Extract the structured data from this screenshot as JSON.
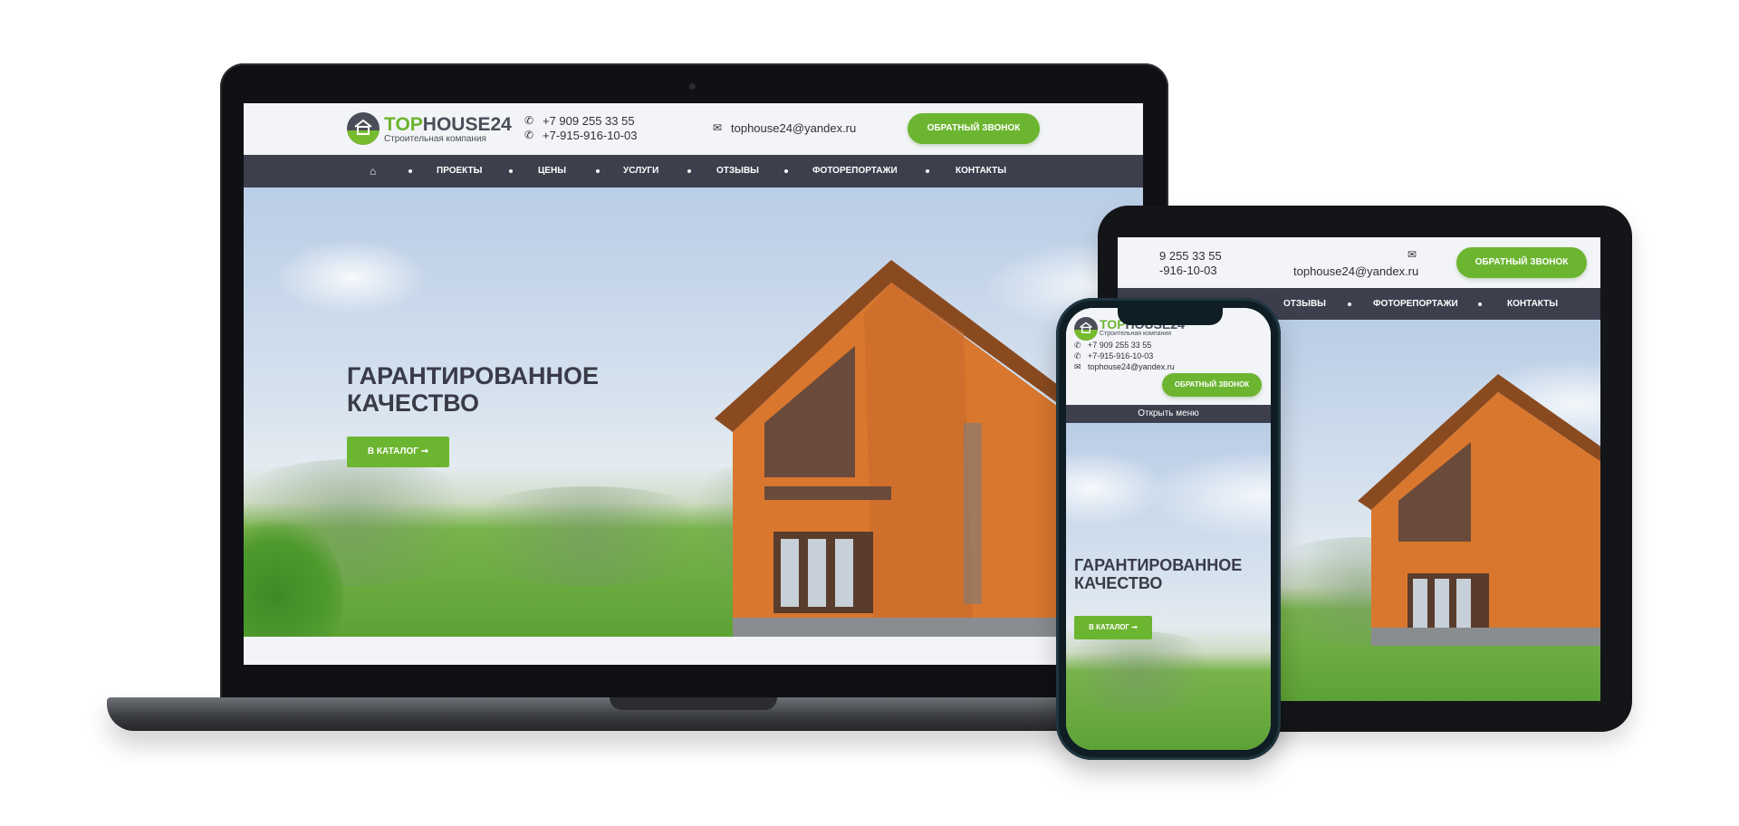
{
  "brand": {
    "logo_top": "TOP",
    "logo_rest": "HOUSE24",
    "tagline": "Строительная компания"
  },
  "contacts": {
    "phone1": "+7 909 255 33 55",
    "phone2": "+7-915-916-10-03",
    "email": "tophouse24@yandex.ru",
    "tablet_phone1": "9 255 33 55",
    "tablet_phone2": "-916-10-03"
  },
  "cta": {
    "callback": "ОБРАТНЫЙ ЗВОНОК"
  },
  "nav": {
    "items": [
      "ПРОЕКТЫ",
      "ЦЕНЫ",
      "УСЛУГИ",
      "ОТЗЫВЫ",
      "ФОТОРЕПОРТАЖИ",
      "КОНТАКТЫ"
    ],
    "tablet_items": [
      "ОТЗЫВЫ",
      "ФОТОРЕПОРТАЖИ",
      "КОНТАКТЫ"
    ],
    "mobile_menu": "Открыть меню"
  },
  "hero": {
    "line1": "ГАРАНТИРОВАННОЕ",
    "line2": "КАЧЕСТВО",
    "button": "В КАТАЛОГ ➞"
  },
  "colors": {
    "accent": "#6cb530",
    "nav_bg": "#3d3f4d",
    "heading": "#3a3b48"
  }
}
